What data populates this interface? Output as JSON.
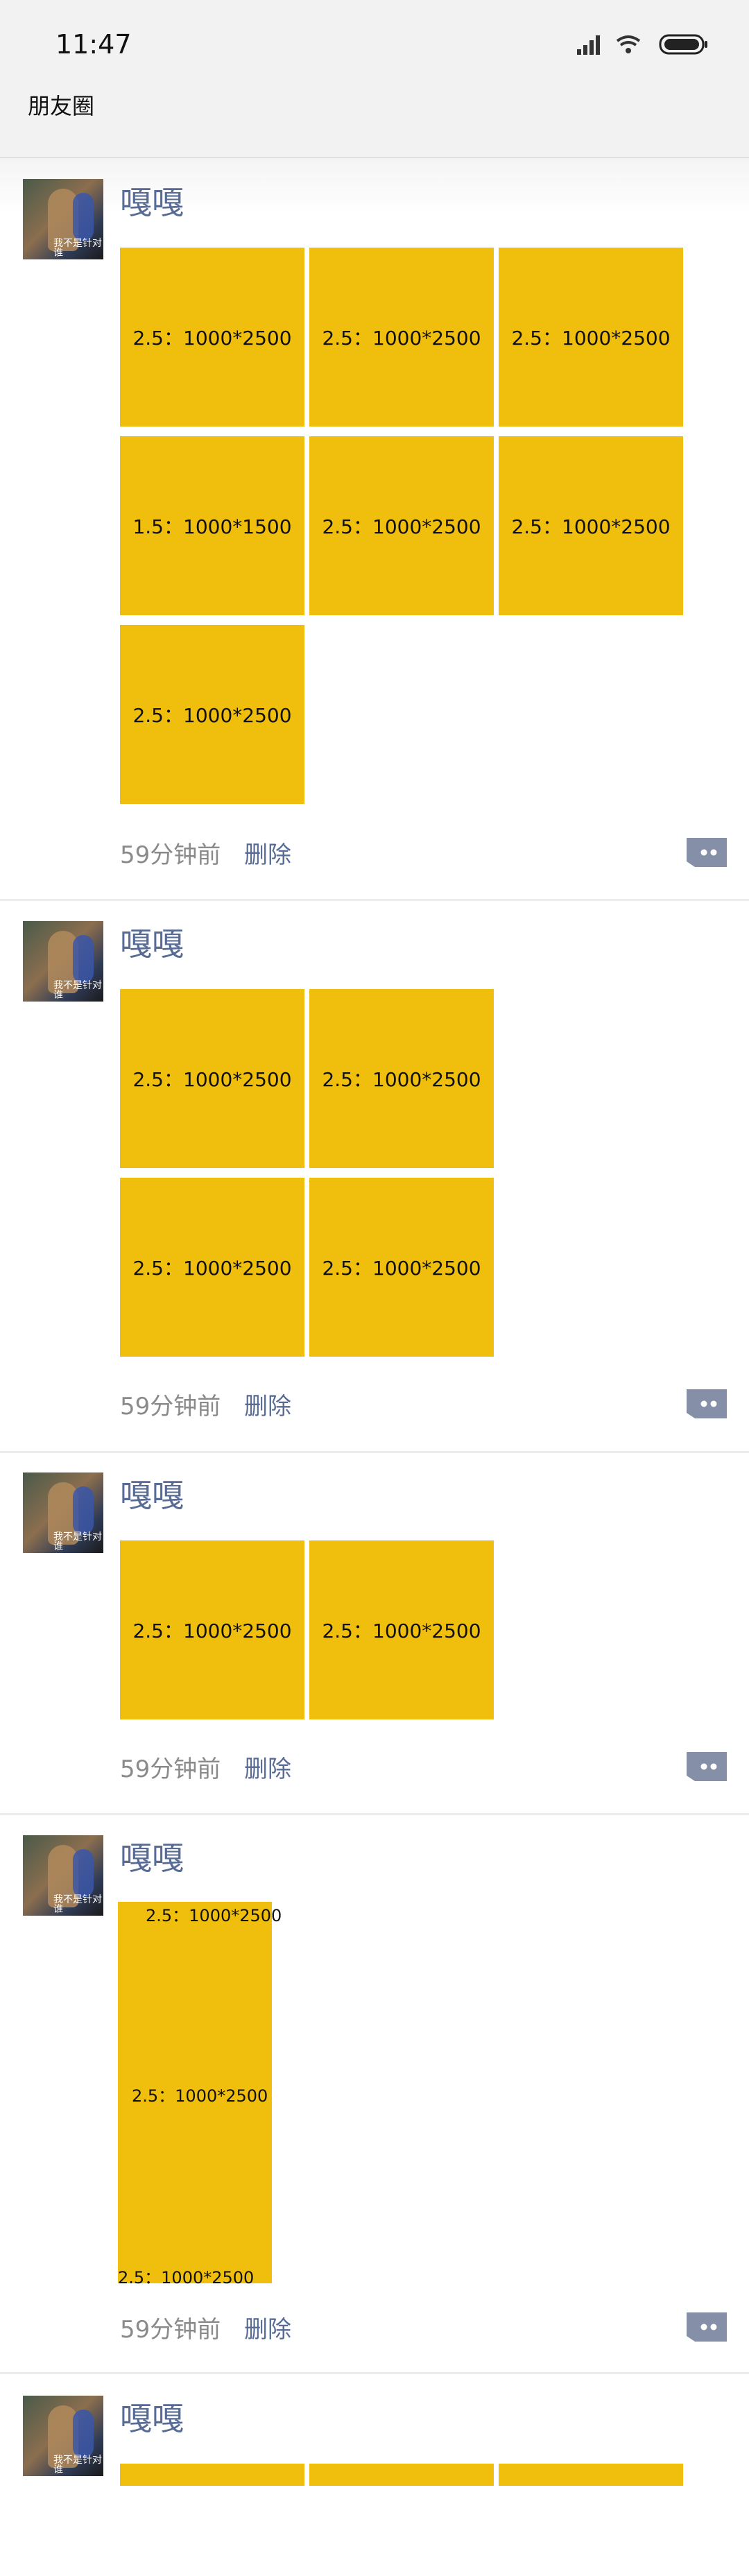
{
  "status": {
    "time": "11:47"
  },
  "title": "朋友圈",
  "posts": [
    {
      "name": "嘎嘎",
      "images": [
        "2.5：1000*2500",
        "2.5：1000*2500",
        "2.5：1000*2500",
        "1.5：1000*1500",
        "2.5：1000*2500",
        "2.5：1000*2500",
        "2.5：1000*2500"
      ],
      "time": "59分钟前",
      "delete": "删除"
    },
    {
      "name": "嘎嘎",
      "images": [
        "2.5：1000*2500",
        "2.5：1000*2500",
        "2.5：1000*2500",
        "2.5：1000*2500"
      ],
      "time": "59分钟前",
      "delete": "删除"
    },
    {
      "name": "嘎嘎",
      "images": [
        "2.5：1000*2500",
        "2.5：1000*2500"
      ],
      "time": "59分钟前",
      "delete": "删除"
    },
    {
      "name": "嘎嘎",
      "images": [
        "2.5：1000*2500",
        "2.5：1000*2500",
        "2.5：1000*2500"
      ],
      "time": "59分钟前",
      "delete": "删除"
    },
    {
      "name": "嘎嘎"
    }
  ],
  "avatar_caption": "我不是针对谁",
  "colors": {
    "image_bg": "#f0bf0e",
    "link": "#576b95",
    "meta": "#8a8a8a"
  },
  "icons": [
    "signal-icon",
    "wifi-icon",
    "battery-icon",
    "comment-icon"
  ]
}
